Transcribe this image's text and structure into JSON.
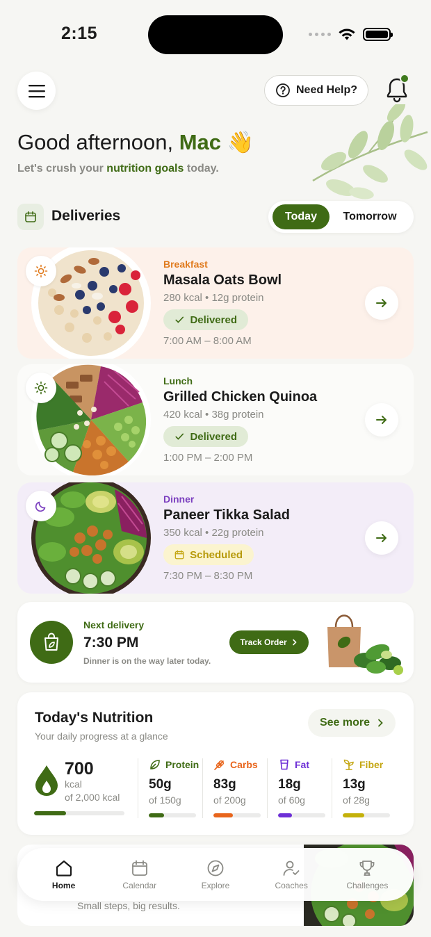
{
  "status_bar": {
    "time": "2:15"
  },
  "header": {
    "help_label": "Need Help?",
    "greeting_prefix": "Good afternoon,",
    "user_name": "Mac",
    "wave_emoji": "👋",
    "subline_pre": "Let's crush your",
    "subline_highlight": "nutrition goals",
    "subline_post": "today."
  },
  "deliveries": {
    "title": "Deliveries",
    "tabs": {
      "today": "Today",
      "tomorrow": "Tomorrow",
      "selected": "Today"
    },
    "meals": [
      {
        "type": "Breakfast",
        "name": "Masala Oats Bowl",
        "macros": "280 kcal • 12g protein",
        "status": "Delivered",
        "time": "7:00 AM – 8:00 AM",
        "icon": "sun-icon"
      },
      {
        "type": "Lunch",
        "name": "Grilled Chicken Quinoa",
        "macros": "420 kcal • 38g protein",
        "status": "Delivered",
        "time": "1:00 PM – 2:00 PM",
        "icon": "sun-icon"
      },
      {
        "type": "Dinner",
        "name": "Paneer Tikka Salad",
        "macros": "350 kcal • 22g protein",
        "status": "Scheduled",
        "time": "7:30 PM – 8:30 PM",
        "icon": "moon-icon"
      }
    ]
  },
  "next_delivery": {
    "label": "Next delivery",
    "time": "7:30 PM",
    "subtitle": "Dinner is on the way later today.",
    "button": "Track Order"
  },
  "nutrition": {
    "title": "Today's Nutrition",
    "subtitle": "Your daily progress at a glance",
    "see_more": "See more",
    "calories": {
      "value": "700",
      "unit": "kcal",
      "goal": "of 2,000 kcal",
      "progress": 0.35
    },
    "macros": [
      {
        "name": "Protein",
        "value": "50g",
        "goal": "of 150g",
        "progress": 0.33,
        "color": "#3f6b15",
        "icon": "leaf-icon"
      },
      {
        "name": "Carbs",
        "value": "83g",
        "goal": "of 200g",
        "progress": 0.41,
        "color": "#e8651c",
        "icon": "wheat-icon"
      },
      {
        "name": "Fat",
        "value": "18g",
        "goal": "of 60g",
        "progress": 0.3,
        "color": "#6d2fd6",
        "icon": "cup-icon"
      },
      {
        "name": "Fiber",
        "value": "13g",
        "goal": "of 28g",
        "progress": 0.46,
        "color": "#c4b10a",
        "icon": "sprout-icon"
      }
    ]
  },
  "tip_card": {
    "subtitle": "Small steps, big results."
  },
  "bottom_nav": [
    {
      "label": "Home",
      "icon": "home-icon",
      "active": true
    },
    {
      "label": "Calendar",
      "icon": "calendar-icon",
      "active": false
    },
    {
      "label": "Explore",
      "icon": "compass-icon",
      "active": false
    },
    {
      "label": "Coaches",
      "icon": "coach-icon",
      "active": false
    },
    {
      "label": "Challenges",
      "icon": "trophy-icon",
      "active": false
    }
  ],
  "colors": {
    "brand_green": "#3f6b15",
    "breakfast_orange": "#e07b1e",
    "lunch_green": "#3f6b15",
    "dinner_purple": "#7b3fbf"
  }
}
